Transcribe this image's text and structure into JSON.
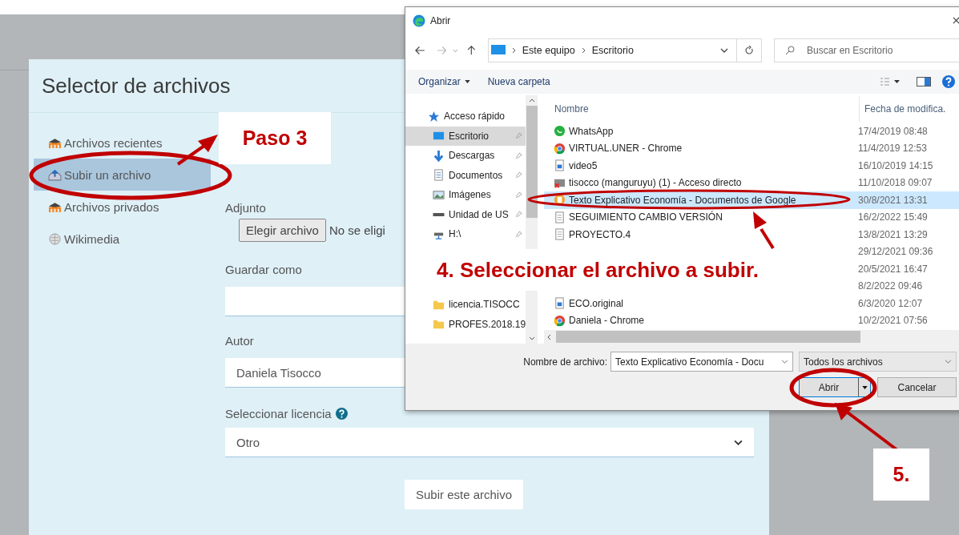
{
  "file_selector": {
    "title": "Selector de archivos",
    "repositories": [
      {
        "kind": "moodle",
        "label": "Archivos recientes",
        "selected": false
      },
      {
        "kind": "upload",
        "label": "Subir un archivo",
        "selected": true
      },
      {
        "kind": "moodle",
        "label": "Archivos privados",
        "selected": false
      },
      {
        "kind": "wiki",
        "label": "Wikimedia",
        "selected": false
      }
    ],
    "attachment": {
      "label": "Adjunto",
      "button": "Elegir archivo",
      "status": "No se eligi"
    },
    "save_as": {
      "label": "Guardar como"
    },
    "author": {
      "label": "Autor",
      "value": "Daniela Tisocco"
    },
    "license": {
      "label": "Seleccionar licencia",
      "value": "Otro"
    },
    "submit": "Subir este archivo"
  },
  "dialog": {
    "title": "Abrir",
    "path": [
      "Este equipo",
      "Escritorio"
    ],
    "search": {
      "placeholder": "Buscar en Escritorio"
    },
    "toolbar": [
      "Organizar",
      "Nueva carpeta"
    ],
    "nav": [
      {
        "kind": "star",
        "label": "Acceso rápido",
        "selected": false,
        "pinned": false
      },
      {
        "kind": "desktop",
        "label": "Escritorio",
        "selected": true,
        "pinned": true
      },
      {
        "kind": "download",
        "label": "Descargas",
        "selected": false,
        "pinned": true
      },
      {
        "kind": "documents",
        "label": "Documentos",
        "selected": false,
        "pinned": true
      },
      {
        "kind": "pictures",
        "label": "Imágenes",
        "selected": false,
        "pinned": true
      },
      {
        "kind": "drive",
        "label": "Unidad de US",
        "selected": false,
        "pinned": true
      },
      {
        "kind": "network",
        "label": "H:\\",
        "selected": false,
        "pinned": true
      }
    ],
    "nav_folders": [
      {
        "kind": "folder",
        "label": "licencia.TISOCC",
        "selected": false
      },
      {
        "kind": "folder",
        "label": "PROFES.2018.19",
        "selected": false
      }
    ],
    "columns": [
      "Nombre",
      "Fecha de modifica."
    ],
    "files": [
      {
        "kind": "whatsapp",
        "name": "WhatsApp",
        "date": "17/4/2019 08:48",
        "selected": false
      },
      {
        "kind": "chrome",
        "name": "VIRTUAL.UNER - Chrome",
        "date": "11/4/2019 12:53",
        "selected": false
      },
      {
        "kind": "video",
        "name": "video5",
        "date": "16/10/2019 14:15",
        "selected": false
      },
      {
        "kind": "shortcut",
        "name": "tisocco (manguruyu) (1) - Acceso directo",
        "date": "11/10/2018 09:07",
        "selected": false
      },
      {
        "kind": "gdoc",
        "name": "Texto Explicativo Economía - Documentos de Google",
        "date": "30/8/2021 13:31",
        "selected": true
      },
      {
        "kind": "doc",
        "name": "SEGUIMIENTO CAMBIO VERSIÓN",
        "date": "16/2/2022 15:49",
        "selected": false
      },
      {
        "kind": "doc",
        "name": "PROYECTO.4",
        "date": "13/8/2021 13:29",
        "selected": false
      },
      {
        "date": "29/12/2021 09:36"
      },
      {
        "date": "20/5/2021 16:47"
      },
      {
        "date": "8/2/2022 09:46"
      },
      {
        "kind": "video",
        "name": "ECO.original",
        "date": "6/3/2020 12:07",
        "selected": false
      },
      {
        "kind": "chrome",
        "name": "Daniela - Chrome",
        "date": "10/2/2021 07:56",
        "selected": false
      }
    ],
    "file_name": {
      "label": "Nombre de archivo:",
      "value": "Texto Explicativo Economía - Docu"
    },
    "file_type": "Todos los archivos",
    "buttons": [
      "Abrir",
      "Cancelar"
    ]
  },
  "annotations": [
    "Paso 3",
    "4. Seleccionar el archivo a subir.",
    "5."
  ]
}
